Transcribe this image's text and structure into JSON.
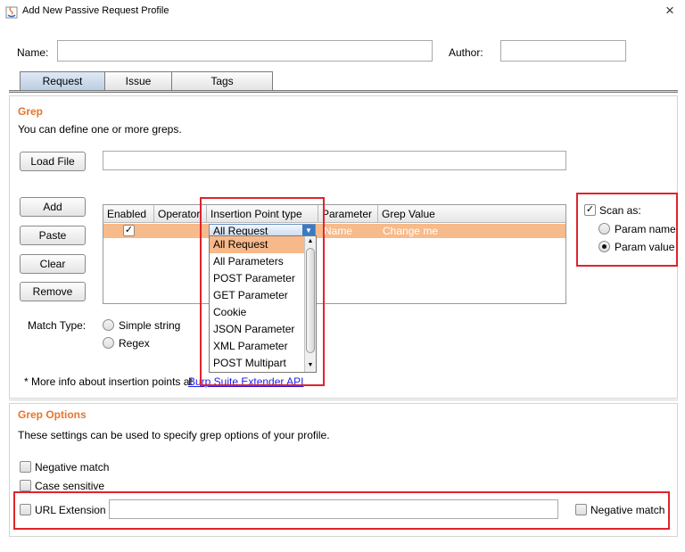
{
  "window": {
    "title": "Add New Passive Request Profile",
    "close_glyph": "×"
  },
  "header": {
    "name_label": "Name:",
    "name_value": "",
    "author_label": "Author:",
    "author_value": ""
  },
  "tabs": [
    {
      "label": "Request",
      "active": true
    },
    {
      "label": "Issue"
    },
    {
      "label": "Tags"
    }
  ],
  "grep": {
    "title": "Grep",
    "description": "You can define one or more greps.",
    "load_file_label": "Load File",
    "load_file_value": "",
    "buttons": {
      "add": "Add",
      "paste": "Paste",
      "clear": "Clear",
      "remove": "Remove"
    },
    "table": {
      "columns": [
        "Enabled",
        "Operator",
        "Insertion Point type",
        "Parameter",
        "Grep Value"
      ],
      "rows": [
        {
          "enabled": true,
          "operator": "",
          "insertion_point": "All Request",
          "parameter": "Name",
          "grep_value": "Change me"
        }
      ]
    },
    "dropdown_options": [
      "All Request",
      "All Parameters",
      "POST Parameter",
      "GET Parameter",
      "Cookie",
      "JSON Parameter",
      "XML Parameter",
      "POST Multipart"
    ],
    "match_type": {
      "label": "Match Type:",
      "options": [
        "Simple string",
        "Regex"
      ]
    },
    "scan_as": {
      "label": "Scan as:",
      "checked": true,
      "options": [
        "Param name",
        "Param value"
      ],
      "selected": "Param value"
    },
    "note_prefix": "* More info about insertion points at ",
    "note_link": "Burp Suite Extender API"
  },
  "grep_options": {
    "title": "Grep Options",
    "description": "These settings can be used to specify grep options of your profile.",
    "negative_match": "Negative match",
    "case_sensitive": "Case sensitive",
    "url_extension": "URL Extension",
    "url_extension_value": "",
    "url_negative_match": "Negative match"
  },
  "colors": {
    "accent": "#e8742a",
    "highlight": "#e0232c",
    "row_selected": "#f7ba8a",
    "dropdown_selected": "#f8b98a"
  }
}
